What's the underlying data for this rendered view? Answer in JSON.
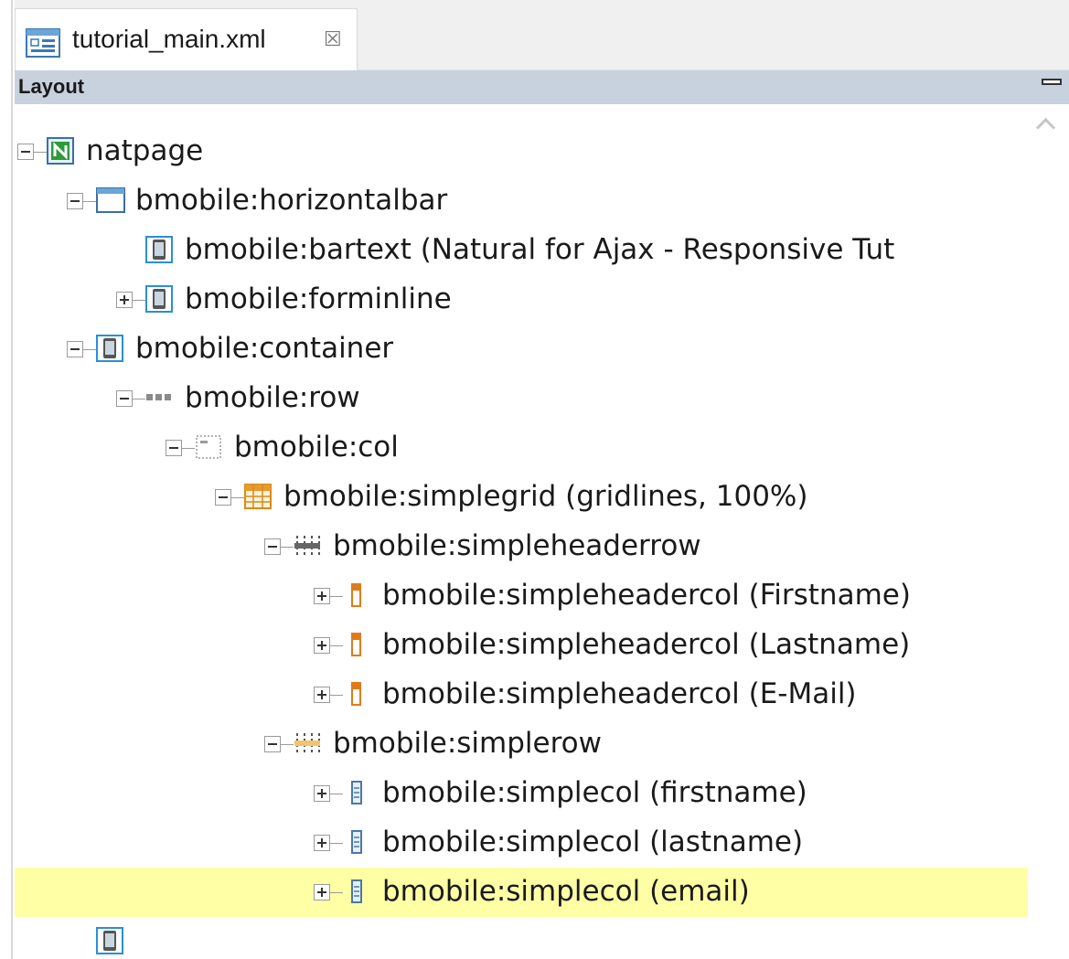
{
  "tab": {
    "label": "tutorial_main.xml",
    "icon": "xml-layout-icon",
    "close_icon": "close-icon",
    "close_glyph": "☒"
  },
  "section": {
    "title": "Layout",
    "minimize_icon": "minimize-icon"
  },
  "tree": [
    {
      "label": "natpage",
      "icon": "natpage-icon",
      "expander": "collapse",
      "depth": 0,
      "selected": false
    },
    {
      "label": "bmobile:horizontalbar",
      "icon": "horizontalbar-icon",
      "expander": "collapse",
      "depth": 1,
      "selected": false
    },
    {
      "label": "bmobile:bartext (Natural for Ajax - Responsive Tut",
      "icon": "device-icon",
      "expander": "none",
      "depth": 2,
      "selected": false
    },
    {
      "label": "bmobile:forminline",
      "icon": "device-icon",
      "expander": "expand",
      "depth": 2,
      "selected": false
    },
    {
      "label": "bmobile:container",
      "icon": "device-icon",
      "expander": "collapse",
      "depth": 1,
      "selected": false
    },
    {
      "label": "bmobile:row",
      "icon": "row-icon",
      "expander": "collapse",
      "depth": 2,
      "selected": false
    },
    {
      "label": "bmobile:col",
      "icon": "col-icon",
      "expander": "collapse",
      "depth": 3,
      "selected": false
    },
    {
      "label": "bmobile:simplegrid (gridlines, 100%)",
      "icon": "grid-icon",
      "expander": "collapse",
      "depth": 4,
      "selected": false
    },
    {
      "label": "bmobile:simpleheaderrow",
      "icon": "headerrow-icon",
      "expander": "collapse",
      "depth": 5,
      "selected": false
    },
    {
      "label": "bmobile:simpleheadercol (Firstname)",
      "icon": "headercol-icon",
      "expander": "expand",
      "depth": 6,
      "selected": false
    },
    {
      "label": "bmobile:simpleheadercol (Lastname)",
      "icon": "headercol-icon",
      "expander": "expand",
      "depth": 6,
      "selected": false
    },
    {
      "label": "bmobile:simpleheadercol (E-Mail)",
      "icon": "headercol-icon",
      "expander": "expand",
      "depth": 6,
      "selected": false
    },
    {
      "label": "bmobile:simplerow",
      "icon": "simplerow-icon",
      "expander": "collapse",
      "depth": 5,
      "selected": false
    },
    {
      "label": "bmobile:simplecol (firstname)",
      "icon": "simplecol-icon",
      "expander": "expand",
      "depth": 6,
      "selected": false
    },
    {
      "label": "bmobile:simplecol (lastname)",
      "icon": "simplecol-icon",
      "expander": "expand",
      "depth": 6,
      "selected": false
    },
    {
      "label": "bmobile:simplecol (email)",
      "icon": "simplecol-icon",
      "expander": "expand",
      "depth": 6,
      "selected": true
    }
  ],
  "colors": {
    "selection": "#ffffa6",
    "header_bg": "#c8d1de",
    "tab_bar_bg": "#f0f0f0"
  }
}
